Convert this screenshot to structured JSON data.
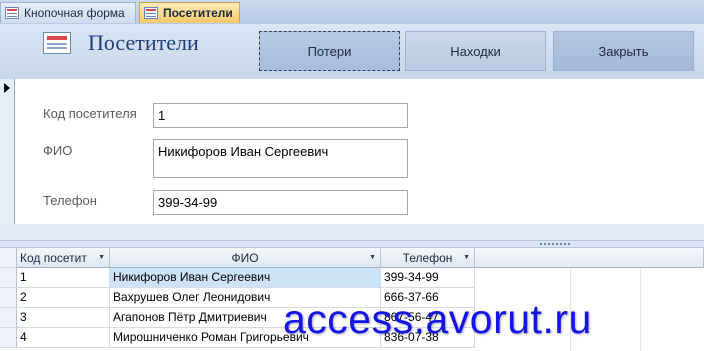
{
  "tabs": [
    {
      "label": "Кнопочная форма"
    },
    {
      "label": "Посетители"
    }
  ],
  "header": {
    "title": "Посетители",
    "buttons": [
      {
        "label": "Потери"
      },
      {
        "label": "Находки"
      },
      {
        "label": "Закрыть"
      }
    ]
  },
  "form": {
    "id_label": "Код посетителя",
    "id_value": "1",
    "name_label": "ФИО",
    "name_value": "Никифоров Иван Сергеевич",
    "phone_label": "Телефон",
    "phone_value": "399-34-99"
  },
  "datasheet": {
    "columns": [
      "Код посетит",
      "ФИО",
      "Телефон"
    ],
    "rows": [
      [
        "1",
        "Никифоров Иван Сергеевич",
        "399-34-99"
      ],
      [
        "2",
        "Вахрушев Олег Леонидович",
        "666-37-66"
      ],
      [
        "3",
        "Агапонов Пётр Дмитриевич",
        "867-56-47"
      ],
      [
        "4",
        "Мирошниченко Роман Григорьевич",
        "836-07-38"
      ]
    ]
  },
  "watermark": "access.avorut.ru"
}
